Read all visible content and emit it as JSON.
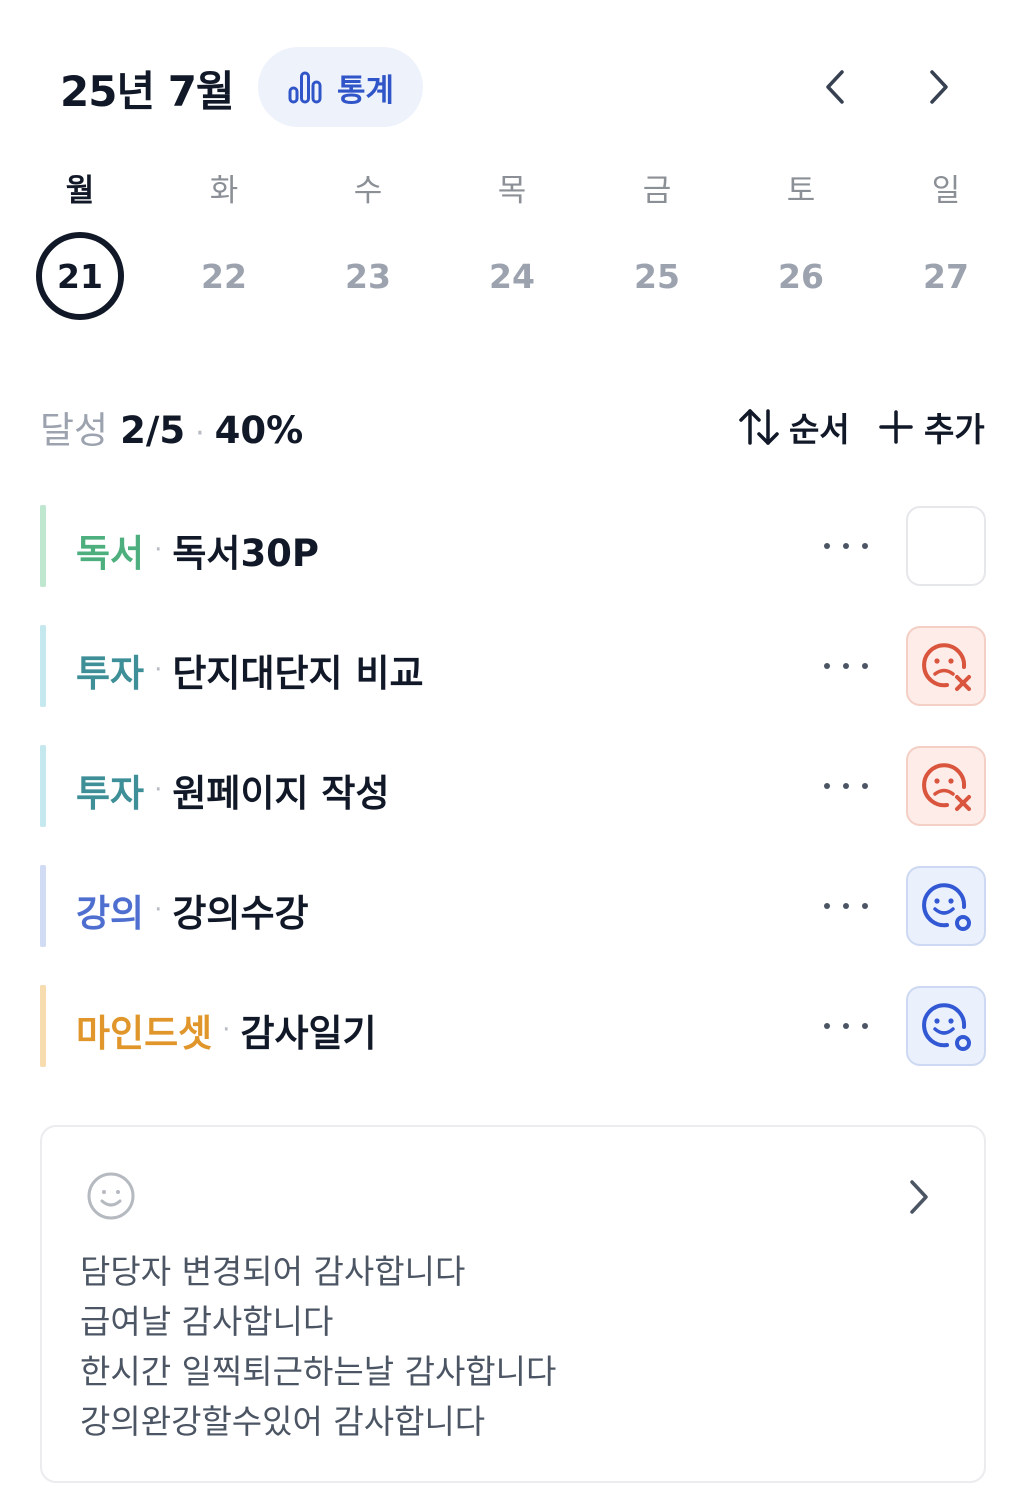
{
  "header": {
    "month_title": "25년 7월",
    "stats_label": "통계",
    "stats_icon": "bar-chart-icon",
    "prev_icon": "chevron-left-icon",
    "next_icon": "chevron-right-icon"
  },
  "week": {
    "days": [
      "월",
      "화",
      "수",
      "목",
      "금",
      "토",
      "일"
    ],
    "dates": [
      "21",
      "22",
      "23",
      "24",
      "25",
      "26",
      "27"
    ],
    "selected_date": "21"
  },
  "summary": {
    "label": "달성",
    "count": "2/5",
    "percent": "40%",
    "sort_label": "순서",
    "sort_icon": "sort-arrows-icon",
    "add_label": "추가",
    "add_icon": "plus-icon"
  },
  "tasks": [
    {
      "category": "독서",
      "title": "독서30P",
      "color": "#4caf7d",
      "bar_color": "#bfe6cf",
      "status": "none"
    },
    {
      "category": "투자",
      "title": "단지대단지 비교",
      "color": "#3f8f98",
      "bar_color": "#c4e8ee",
      "status": "fail"
    },
    {
      "category": "투자",
      "title": "원페이지 작성",
      "color": "#3f8f98",
      "bar_color": "#c4e8ee",
      "status": "fail"
    },
    {
      "category": "강의",
      "title": "강의수강",
      "color": "#4f6fd0",
      "bar_color": "#d2dbf4",
      "status": "done"
    },
    {
      "category": "마인드셋",
      "title": "감사일기",
      "color": "#e0962a",
      "bar_color": "#f7dcb0",
      "status": "done"
    }
  ],
  "colors": {
    "accent_blue": "#2f55c8",
    "fail_red": "#d9553d",
    "done_blue": "#3358d4"
  },
  "diary": {
    "icon": "smiley-icon",
    "lines": [
      "담당자 변경되어 감사합니다",
      "급여날 감사합니다",
      "한시간 일찍퇴근하는날 감사합니다",
      "강의완강할수있어 감사합니다"
    ]
  }
}
